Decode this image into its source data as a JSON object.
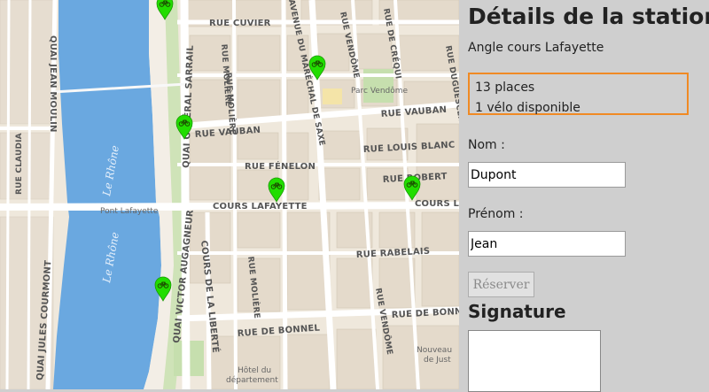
{
  "map": {
    "streets": {
      "rue_cuvier": "RUE CUVIER",
      "rue_vauban_left": "RUE VAUBAN",
      "rue_vauban_right": "RUE VAUBAN",
      "rue_fenelon": "RUE FÉNELON",
      "rue_louis_blanc": "RUE LOUIS BLANC",
      "rue_robert": "RUE ROBERT",
      "cours_lafayette": "COURS LAFAYETTE",
      "cours_lafayette_right": "COURS LA",
      "rue_rabelais": "RUE RABELAIS",
      "rue_de_bonnel_left": "RUE DE BONNEL",
      "rue_de_bonnel_right": "RUE DE BONN",
      "quai_jean_moulin": "QUAI JEAN MOULIN",
      "quai_general_sarrail": "QUAI GÉNÉRAL SARRAIL",
      "quai_victor_augagneur": "QUAI VICTOR AUGAGNEUR",
      "cours_de_la_liberte": "COURS DE LA LIBERTÉ",
      "rue_moliere_top": "RUE MOLIÈRE",
      "rue_moliere_mid": "RUE MOLIÈRE",
      "rue_moliere_bottom": "RUE MOLIÈRE",
      "avenue_marechal_de_saxe": "AVENUE DU MARÉCHAL DE SAXE",
      "rue_vendome_top": "RUE VENDÔME",
      "rue_vendome_bottom": "RUE VENDÔME",
      "rue_de_crequi": "RUE DE CRÉQUI",
      "rue_duguesclin": "RUE DUGUESCLIN",
      "rue_claudia": "RUE CLAUDIA",
      "quai_jules_courmont": "QUAI JULES COURMONT"
    },
    "places": {
      "parc_vendome": "Parc Vendôme",
      "pont_lafayette": "Pont Lafayette",
      "hotel_departement_1": "Hôtel du",
      "hotel_departement_2": "département",
      "nouveau_de_just_1": "Nouveau",
      "nouveau_de_just_2": "de Just"
    },
    "river": "Le Rhône",
    "marker_color": "#22dd00",
    "marker_icon": "bicycle-icon"
  },
  "panel": {
    "title": "Détails de la station",
    "address": "Angle cours Lafayette",
    "places": "13 places",
    "bikes": "1 vélo disponible",
    "nom_label": "Nom :",
    "nom_value": "Dupont",
    "prenom_label": "Prénom :",
    "prenom_value": "Jean",
    "reserve_label": "Réserver",
    "signature_title": "Signature",
    "accent_color": "#f08a24"
  }
}
